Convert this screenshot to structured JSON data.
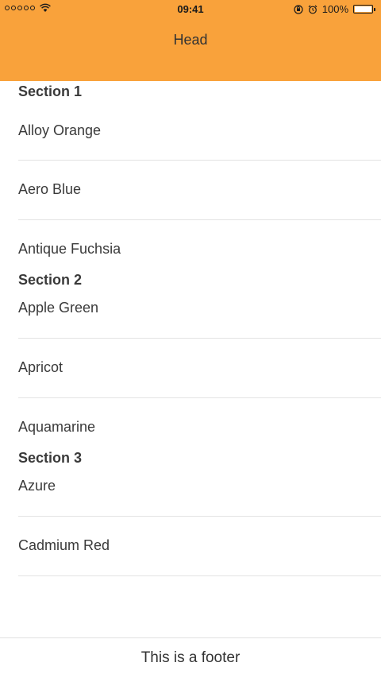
{
  "status_bar": {
    "time": "09:41",
    "battery_percent": "100%",
    "signal_bars": 5
  },
  "nav": {
    "title": "Head"
  },
  "sections": [
    {
      "title": "Section 1",
      "items": [
        "Alloy Orange",
        "Aero Blue",
        "Antique Fuchsia"
      ]
    },
    {
      "title": "Section 2",
      "items": [
        "Apple Green",
        "Apricot",
        "Aquamarine"
      ]
    },
    {
      "title": "Section 3",
      "items": [
        "Azure",
        "Cadmium Red"
      ]
    }
  ],
  "footer": {
    "text": "This is a footer"
  },
  "colors": {
    "header_bg": "#f9a23b",
    "divider": "#e3e3e3",
    "text": "#333333"
  }
}
